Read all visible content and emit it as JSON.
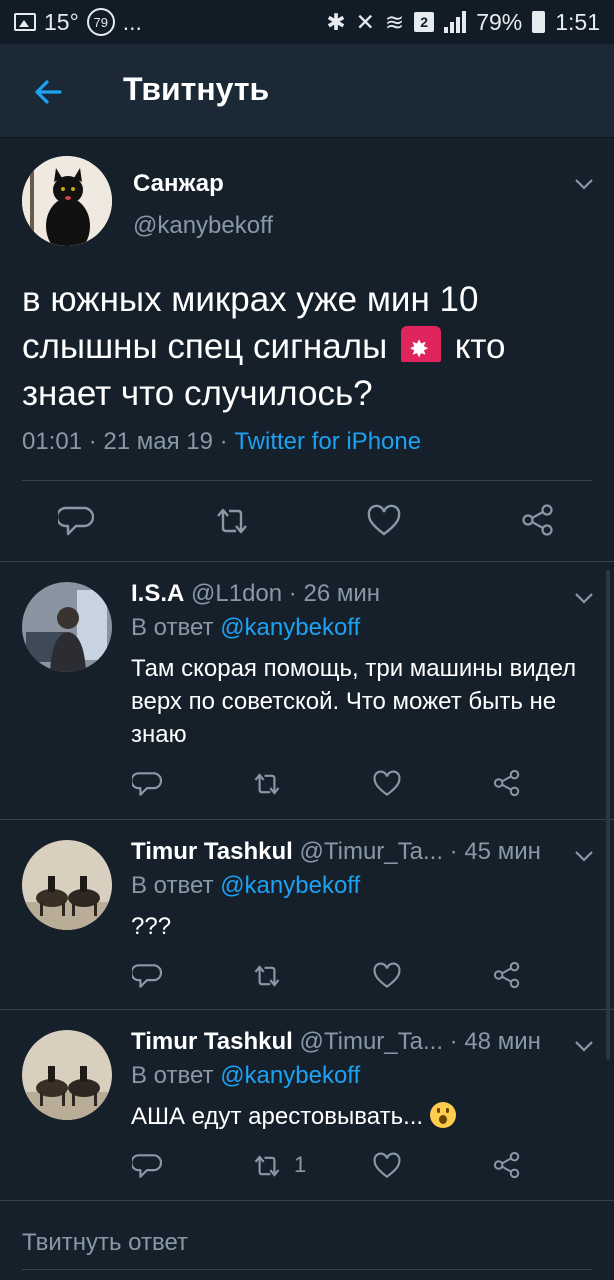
{
  "status_bar": {
    "temperature": "15°",
    "notif_badge": "79",
    "more": "...",
    "sim_badge": "2",
    "battery": "79%",
    "time": "1:51"
  },
  "header": {
    "title": "Твитнуть"
  },
  "main_tweet": {
    "name": "Санжар",
    "handle": "@kanybekoff",
    "text_before_emoji": "в южных микрах уже мин 10 слышны спец сигналы",
    "text_after_emoji": "кто знает что случилось?",
    "time": "01:01",
    "date": "21 мая 19",
    "source": "Twitter for iPhone"
  },
  "replies": [
    {
      "name": "I.S.A",
      "handle": "@L1don",
      "time": "26 мин",
      "replying_label": "В ответ",
      "replying_to": "@kanybekoff",
      "text": "Там скорая помощь, три машины видел верх по советской. Что может быть не знаю",
      "retweets": ""
    },
    {
      "name": "Timur Tashkul",
      "handle": "@Timur_Ta...",
      "time": "45 мин",
      "replying_label": "В ответ",
      "replying_to": "@kanybekoff",
      "text": "???",
      "retweets": ""
    },
    {
      "name": "Timur Tashkul",
      "handle": "@Timur_Ta...",
      "time": "48 мин",
      "replying_label": "В ответ",
      "replying_to": "@kanybekoff",
      "text": "АША едут арестовывать...",
      "retweets": "1"
    }
  ],
  "composer": {
    "placeholder": "Твитнуть ответ"
  },
  "colors": {
    "background": "#15202b",
    "accent": "#1da1f2",
    "muted": "#8899a6"
  }
}
